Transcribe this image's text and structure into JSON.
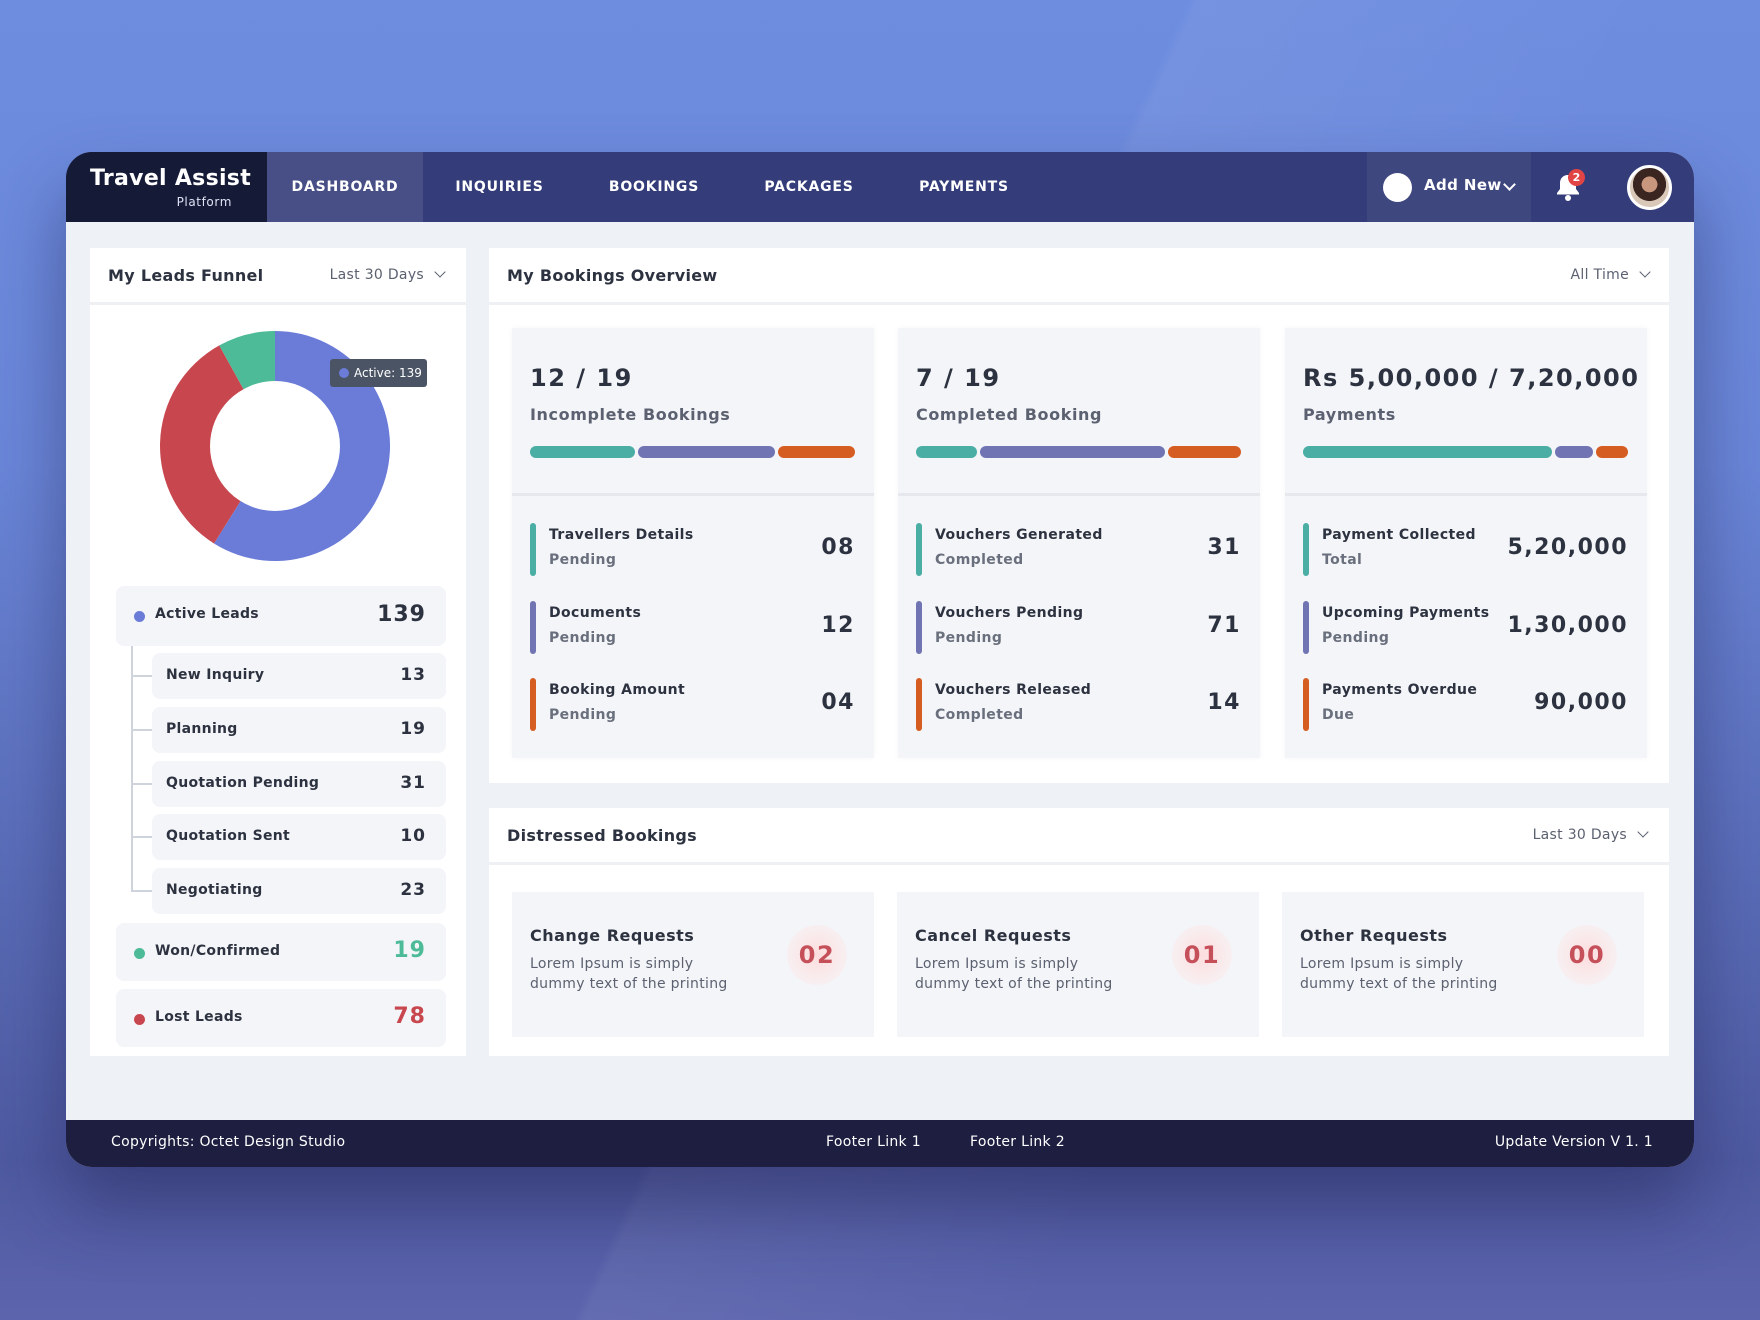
{
  "brand": {
    "title": "Travel Assist",
    "subtitle": "Platform"
  },
  "nav": {
    "tabs": [
      {
        "label": "DASHBOARD",
        "active": true
      },
      {
        "label": "INQUIRIES",
        "active": false
      },
      {
        "label": "BOOKINGS",
        "active": false
      },
      {
        "label": "PACKAGES",
        "active": false
      },
      {
        "label": "PAYMENTS",
        "active": false
      }
    ],
    "add_new_label": "Add New",
    "notification_count": "2",
    "icons": {
      "bell": "bell-icon",
      "chevron": "chevron-down-icon",
      "avatar": "user-avatar"
    }
  },
  "leads_funnel": {
    "title": "My Leads Funnel",
    "filter": "Last 30 Days",
    "tooltip": "Active: 139",
    "active": {
      "label": "Active Leads",
      "value": "139",
      "color": "#6a7bd8"
    },
    "stages": [
      {
        "label": "New Inquiry",
        "value": "13"
      },
      {
        "label": "Planning",
        "value": "19"
      },
      {
        "label": "Quotation Pending",
        "value": "31"
      },
      {
        "label": "Quotation Sent",
        "value": "10"
      },
      {
        "label": "Negotiating",
        "value": "23"
      }
    ],
    "won": {
      "label": "Won/Confirmed",
      "value": "19",
      "color": "#4dbb97"
    },
    "lost": {
      "label": "Lost Leads",
      "value": "78",
      "color": "#c8474f"
    }
  },
  "chart_data": {
    "type": "pie",
    "title": "My Leads Funnel",
    "categories": [
      "Active",
      "Lost",
      "Won/Confirmed"
    ],
    "values": [
      139,
      78,
      19
    ],
    "colors": [
      "#6a7bd8",
      "#c8474f",
      "#4dbb97"
    ],
    "donut": true
  },
  "bookings_overview": {
    "title": "My Bookings Overview",
    "filter": "All Time",
    "colors": {
      "teal": "#4aaea5",
      "purple": "#7074b3",
      "orange": "#d65d22"
    },
    "panels": [
      {
        "headline": "12 / 19",
        "label": "Incomplete Bookings",
        "bar": [
          0.33,
          0.43,
          0.24
        ],
        "items": [
          {
            "title": "Travellers Details",
            "status": "Pending",
            "value": "08"
          },
          {
            "title": "Documents",
            "status": "Pending",
            "value": "12"
          },
          {
            "title": "Booking Amount",
            "status": "Pending",
            "value": "04"
          }
        ]
      },
      {
        "headline": "7 / 19",
        "label": "Completed Booking",
        "bar": [
          0.19,
          0.58,
          0.23
        ],
        "items": [
          {
            "title": "Vouchers Generated",
            "status": "Completed",
            "value": "31"
          },
          {
            "title": "Vouchers Pending",
            "status": "Pending",
            "value": "71"
          },
          {
            "title": "Vouchers Released",
            "status": "Completed",
            "value": "14"
          }
        ]
      },
      {
        "headline": "Rs 5,00,000 / 7,20,000",
        "label": "Payments",
        "bar": [
          0.78,
          0.12,
          0.1
        ],
        "items": [
          {
            "title": "Payment Collected",
            "status": "Total",
            "value": "5,20,000"
          },
          {
            "title": "Upcoming Payments",
            "status": "Pending",
            "value": "1,30,000"
          },
          {
            "title": "Payments Overdue",
            "status": "Due",
            "value": "90,000"
          }
        ]
      }
    ]
  },
  "distressed": {
    "title": "Distressed Bookings",
    "filter": "Last 30 Days",
    "items": [
      {
        "title": "Change Requests",
        "line1": "Lorem Ipsum is simply",
        "line2": "dummy text of the printing",
        "value": "02"
      },
      {
        "title": "Cancel Requests",
        "line1": "Lorem Ipsum is simply",
        "line2": "dummy text of the printing",
        "value": "01"
      },
      {
        "title": "Other Requests",
        "line1": "Lorem Ipsum is simply",
        "line2": "dummy text of the printing",
        "value": "00"
      }
    ]
  },
  "footer": {
    "copyright": "Copyrights: Octet Design Studio",
    "link1": "Footer Link 1",
    "link2": "Footer Link 2",
    "version": "Update Version V 1. 1"
  }
}
